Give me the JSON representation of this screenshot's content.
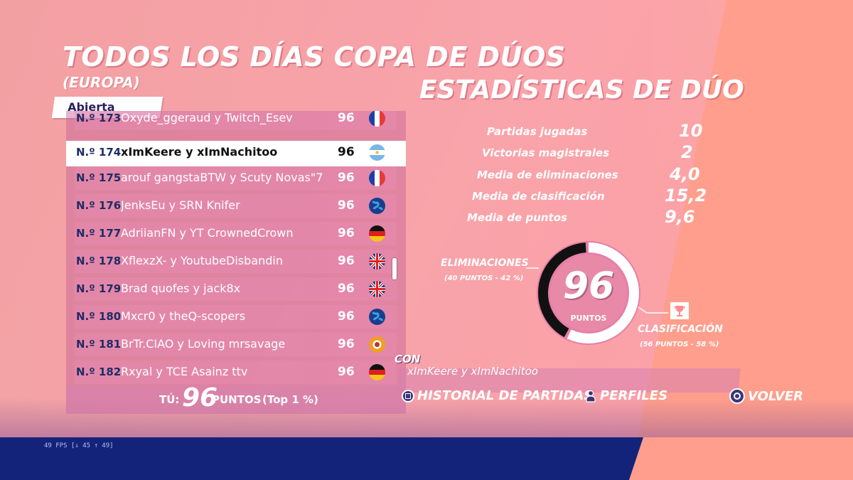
{
  "event": {
    "title": "TODOS LOS DÍAS COPA DE DÚOS",
    "region": "(EUROPA)",
    "division": "Abierta"
  },
  "leaderboard": {
    "rows": [
      {
        "rank": "N.º 173",
        "names": "Oxyde_ggeraud y Twitch_Esev",
        "score": "96",
        "flag": "fr",
        "highlighted": false
      },
      {
        "rank": "N.º 174",
        "names": "xImKeere y xImNachitoo",
        "score": "96",
        "flag": "ar",
        "highlighted": true
      },
      {
        "rank": "N.º 175",
        "names": "arouf gangstaBTW y Scuty Novas\"7",
        "score": "96",
        "flag": "fr",
        "highlighted": false
      },
      {
        "rank": "N.º 176",
        "names": "JenksEu y SRN Knifer",
        "score": "96",
        "flag": "globe",
        "highlighted": false
      },
      {
        "rank": "N.º 177",
        "names": "AdriianFN y YT CrownedCrown",
        "score": "96",
        "flag": "de",
        "highlighted": false
      },
      {
        "rank": "N.º 178",
        "names": "XflexzX- y YoutubeDisbandin",
        "score": "96",
        "flag": "gb",
        "highlighted": false
      },
      {
        "rank": "N.º 179",
        "names": "Brad quofes y jack8x",
        "score": "96",
        "flag": "gb",
        "highlighted": false
      },
      {
        "rank": "N.º 180",
        "names": "Mxcr0 y theQ-scopers",
        "score": "96",
        "flag": "globe",
        "highlighted": false
      },
      {
        "rank": "N.º 181",
        "names": "BrTr.CIAO y Loving mrsavage",
        "score": "96",
        "flag": "other",
        "highlighted": false
      },
      {
        "rank": "N.º 182",
        "names": "Rxyal y TCE Asainz ttv",
        "score": "96",
        "flag": "de",
        "highlighted": false
      }
    ],
    "you": {
      "label": "TÚ:",
      "score": "96",
      "points_label": "PUNTOS",
      "top": "(Top 1 %)"
    }
  },
  "stats": {
    "title": "ESTADÍSTICAS DE DÚO",
    "items": [
      {
        "label": "Partidas jugadas",
        "value": "10"
      },
      {
        "label": "Victorias magistrales",
        "value": "2"
      },
      {
        "label": "Media de eliminaciones",
        "value": "4,0"
      },
      {
        "label": "Media de clasificación",
        "value": "15,2"
      },
      {
        "label": "Media de puntos",
        "value": "9,6"
      }
    ],
    "donut": {
      "total": "96",
      "total_label": "PUNTOS",
      "elim_fraction": 0.42,
      "elim_title": "ELIMINACIONES",
      "elim_sub": "(40 PUNTOS - 42 %)",
      "clas_title": "CLASIFICACIÓN",
      "clas_sub": "(56 PUNTOS - 58 %)",
      "colors": {
        "elim": "#111111",
        "clas": "#ffffff"
      }
    }
  },
  "with": {
    "label": "CON",
    "names": "xImKeere y xImNachitoo"
  },
  "buttons": {
    "history": "HISTORIAL DE PARTIDAS",
    "profiles": "PERFILES",
    "back": "VOLVER"
  },
  "overlay": {
    "fps": "49 FPS [↓ 45 ↑ 49]"
  }
}
